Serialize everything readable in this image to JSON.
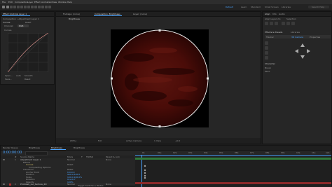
{
  "menu": [
    "File",
    "Edit",
    "Composition",
    "Layer",
    "Effect",
    "Animation",
    "View",
    "Window",
    "Help"
  ],
  "workspaces": [
    {
      "label": "Default",
      "active": true
    },
    {
      "label": "Learn",
      "active": false
    },
    {
      "label": "Standard",
      "active": false
    },
    {
      "label": "Small Screen",
      "active": false
    },
    {
      "label": "Libraries",
      "active": false
    }
  ],
  "search_help": "Search Help",
  "effect_controls": {
    "tab": "Effect Controls Layer 1",
    "breadcrumb": "Composition • Adjustment Layer 1",
    "effect_name": "Curves",
    "reset": "Reset",
    "channel_label": "Channel:",
    "channel_value": "RGB",
    "curves_label": "Curves",
    "bottom_labels": [
      "Open...",
      "Auto",
      "Smooth",
      "Save...",
      "Reset"
    ]
  },
  "viewer": {
    "tabs": [
      "Footage: (none)",
      "Composition: Brightness",
      "Layer: (none)"
    ],
    "comp_title": "Composition: Brightness",
    "breadcrumb": "Brightness",
    "bottom_bar": [
      "(50%)",
      "Full",
      "Active Camera",
      "1 View",
      "+0.0"
    ]
  },
  "right_panel": {
    "tabs": [
      "Align",
      "Info",
      "Audio"
    ],
    "align_label": "Align Layers to:",
    "align_value": "Selection",
    "effects_presets": "Effects & Presets",
    "libraries": "Libraries",
    "tracker": "Tracker",
    "properties": "Properties",
    "selected_label": "3D Camera",
    "brush_section": "Character",
    "tool_labels": [
      "Brush",
      "Paint"
    ]
  },
  "timeline": {
    "tabs": [
      "Render Queue",
      "Brightness",
      "Brightness",
      "Brightness"
    ],
    "timecode": "0:00:00:00",
    "search_placeholder": "",
    "columns": [
      "#",
      "Source Name",
      "Mode",
      "T",
      "TrkMat",
      "Parent & Link"
    ],
    "layers": [
      {
        "num": "1",
        "name": "Adjustment Layer 1",
        "mode": "Normal",
        "parent": "None"
      },
      {
        "num": "",
        "name": "Effects",
        "mode": "",
        "parent": ""
      },
      {
        "num": "",
        "name": "Curves",
        "mode": "Reset",
        "parent": ""
      },
      {
        "num": "",
        "name": "Compositing Options",
        "mode": "",
        "parent": ""
      },
      {
        "num": "",
        "name": "Transform",
        "mode": "Reset",
        "parent": ""
      },
      {
        "num": "",
        "name": "Anchor Point",
        "mode": "0.0,0.0",
        "parent": ""
      },
      {
        "num": "",
        "name": "Position",
        "mode": "960.0,540.0",
        "parent": ""
      },
      {
        "num": "",
        "name": "Scale",
        "mode": "100.0,100.0%",
        "parent": ""
      },
      {
        "num": "",
        "name": "Rotation",
        "mode": "0x+0.0°",
        "parent": ""
      },
      {
        "num": "",
        "name": "Opacity",
        "mode": "100%",
        "parent": ""
      },
      {
        "num": "2",
        "name": "Photolab_red_texture_2D",
        "mode": "Normal",
        "parent": "None"
      }
    ],
    "ruler": [
      "0s",
      "01s",
      "02s",
      "03s",
      "04s",
      "05s",
      "06s",
      "07s",
      "08s",
      "09s",
      "10s",
      "11s",
      "12s"
    ],
    "bottom": "Toggle Switches / Modes"
  },
  "colors": {
    "accent": "#4aa3ff",
    "track_green": "#2f7a3a",
    "track_red": "#8a2a2a",
    "texture": "#4a0c08",
    "label_yellow": "#d8c36a"
  },
  "icons": [
    "pointer-icon",
    "hand-icon",
    "zoom-icon",
    "rotate-icon",
    "camera-icon",
    "pan-behind-icon",
    "rectangle-icon",
    "pen-icon",
    "type-icon",
    "brush-icon",
    "clone-icon",
    "eraser-icon",
    "puppet-icon"
  ]
}
